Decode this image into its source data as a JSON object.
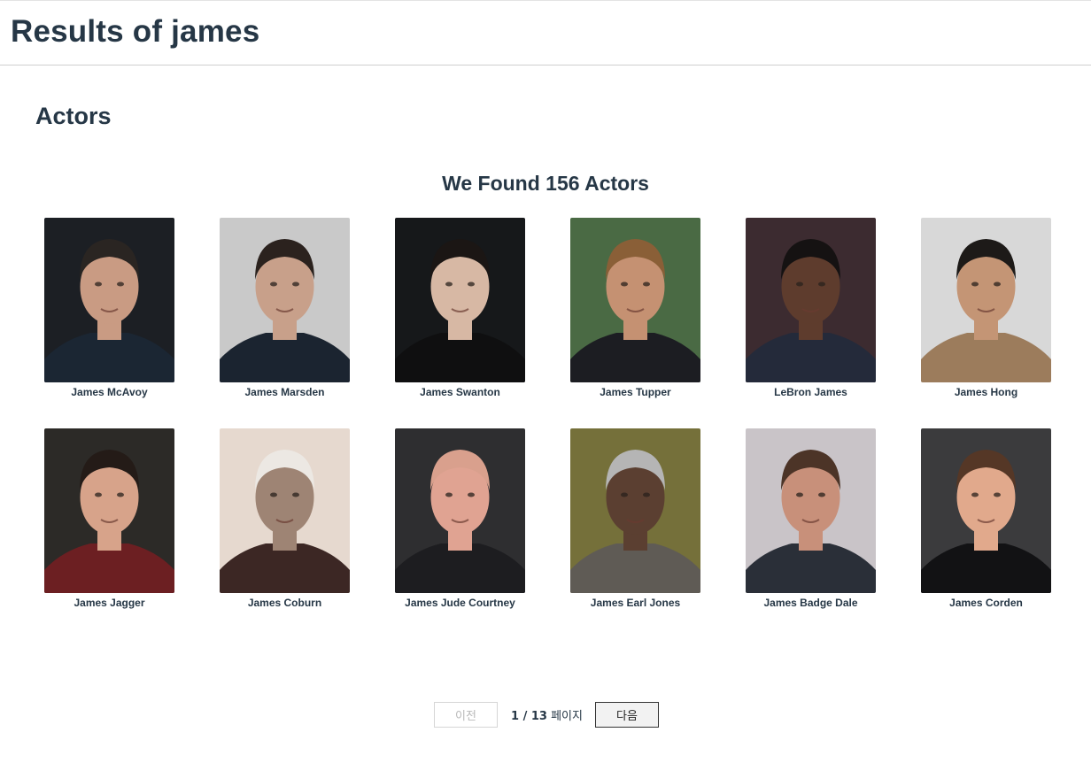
{
  "header": {
    "title": "Results of james"
  },
  "section": {
    "title": "Actors"
  },
  "results": {
    "summary": "We Found 156 Actors"
  },
  "actors": [
    {
      "name": "James McAvoy",
      "bg": "#1c1f24",
      "skin": "#c99b83",
      "hair": "#2a2522",
      "shirt": "#1b2633"
    },
    {
      "name": "James Marsden",
      "bg": "#c9c9c9",
      "skin": "#c8a08a",
      "hair": "#2b221e",
      "shirt": "#1b2430"
    },
    {
      "name": "James Swanton",
      "bg": "#16181a",
      "skin": "#d7b8a4",
      "hair": "#1b1614",
      "shirt": "#0f0f10"
    },
    {
      "name": "James Tupper",
      "bg": "#4a6a44",
      "skin": "#c59172",
      "hair": "#8a5f37",
      "shirt": "#1c1d22"
    },
    {
      "name": "LeBron James",
      "bg": "#3c2b30",
      "skin": "#5e3c2d",
      "hair": "#151212",
      "shirt": "#242a3a"
    },
    {
      "name": "James Hong",
      "bg": "#d8d8d8",
      "skin": "#c49575",
      "hair": "#1d1a18",
      "shirt": "#9c7c5c"
    },
    {
      "name": "James Jagger",
      "bg": "#2c2a27",
      "skin": "#d7a38a",
      "hair": "#241b17",
      "shirt": "#6c1f22"
    },
    {
      "name": "James Coburn",
      "bg": "#e6d9cf",
      "skin": "#9e8474",
      "hair": "#ece8e3",
      "shirt": "#3c2724"
    },
    {
      "name": "James Jude Courtney",
      "bg": "#2e2e30",
      "skin": "#e0a392",
      "hair": "#d9a08d",
      "shirt": "#1d1d20"
    },
    {
      "name": "James Earl Jones",
      "bg": "#75703a",
      "skin": "#5b3f31",
      "hair": "#b5b5b5",
      "shirt": "#5f5b55"
    },
    {
      "name": "James Badge Dale",
      "bg": "#c9c4c8",
      "skin": "#c8907a",
      "hair": "#4c3427",
      "shirt": "#2a2f38"
    },
    {
      "name": "James Corden",
      "bg": "#3b3b3d",
      "skin": "#e1a98c",
      "hair": "#553726",
      "shirt": "#121214"
    }
  ],
  "pagination": {
    "prev_label": "이전",
    "current_page": "1",
    "separator": " / ",
    "total_pages": "13",
    "suffix": " 페이지",
    "next_label": "다음"
  }
}
